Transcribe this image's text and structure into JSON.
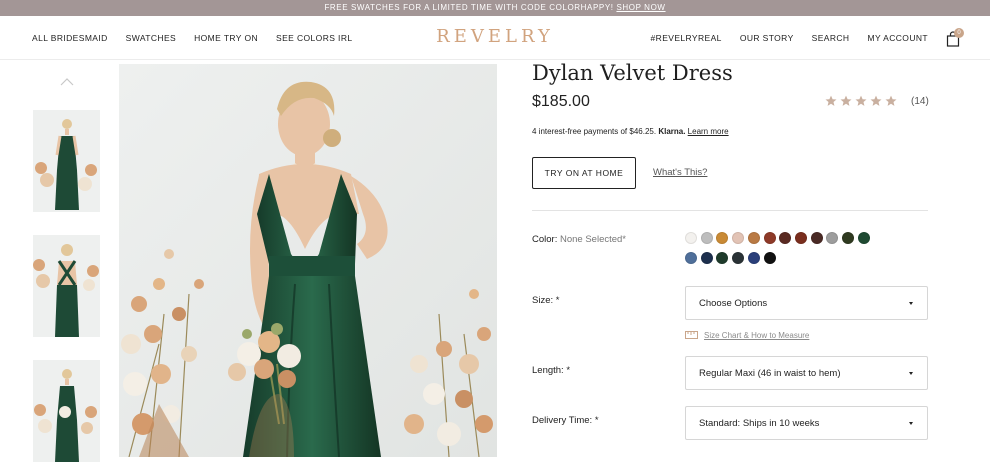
{
  "announcement": {
    "text": "FREE SWATCHES FOR A LIMITED TIME WITH CODE COLORHAPPY!",
    "link": "SHOP NOW"
  },
  "nav": {
    "left": [
      "ALL BRIDESMAID",
      "SWATCHES",
      "HOME TRY ON",
      "SEE COLORS IRL"
    ],
    "logo": "REVELRY",
    "right": [
      "#REVELRYREAL",
      "OUR STORY",
      "SEARCH",
      "MY ACCOUNT"
    ],
    "cart_count": "0"
  },
  "product": {
    "title": "Dylan Velvet Dress",
    "price": "$185.00",
    "rating": 5,
    "review_count": "(14)",
    "klarna_text": "4 interest-free payments of $46.25.",
    "klarna_brand": "Klarna.",
    "klarna_link": "Learn more",
    "try_on_label": "TRY ON AT HOME",
    "whats_this": "What's This?"
  },
  "options": {
    "color_label": "Color:",
    "color_value": "None Selected*",
    "size_label": "Size: *",
    "size_value": "Choose Options",
    "size_chart_link": "Size Chart & How to Measure",
    "length_label": "Length: *",
    "length_value": "Regular Maxi (46 in waist to hem)",
    "delivery_label": "Delivery Time: *",
    "delivery_value": "Standard: Ships in 10 weeks"
  },
  "colors": {
    "accent": "#d1a37e",
    "announce_bg": "#a39696",
    "star": "#c9b0a0",
    "swatches_row1": [
      "#f3f1ee",
      "#bdbdbd",
      "#c98a35",
      "#e2c3b5",
      "#b97a44",
      "#8e3a28",
      "#5a2a22",
      "#7a2e1e",
      "#4a2a25",
      "#9d9d9d",
      "#2f3a20",
      "#1f4a32"
    ],
    "swatches_row2": [
      "#4f6f9a",
      "#1d2f4d",
      "#1f3b2b",
      "#2a3236",
      "#2a3f7a",
      "#111111"
    ]
  }
}
